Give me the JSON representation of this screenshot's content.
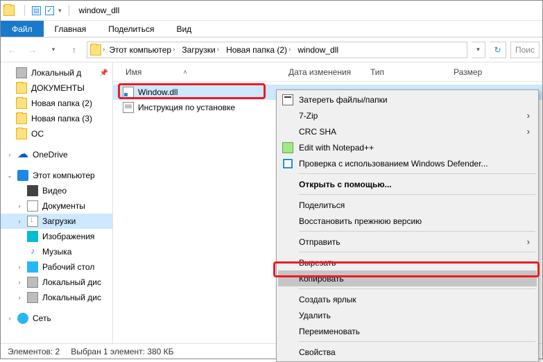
{
  "window": {
    "title": "window_dll"
  },
  "ribbon": {
    "tabs": [
      "Файл",
      "Главная",
      "Поделиться",
      "Вид"
    ]
  },
  "breadcrumb": {
    "segs": [
      "Этот компьютер",
      "Загрузки",
      "Новая папка (2)",
      "window_dll"
    ]
  },
  "search": {
    "placeholder": "Поис"
  },
  "tree": {
    "quick": "Локальный д",
    "items1": [
      "ДОКУМЕНТЫ",
      "Новая папка (2)",
      "Новая папка (3)",
      "ОС"
    ],
    "onedrive": "OneDrive",
    "pc": "Этот компьютер",
    "sub": [
      "Видео",
      "Документы",
      "Загрузки",
      "Изображения",
      "Музыка",
      "Рабочий стол",
      "Локальный дис",
      "Локальный дис"
    ],
    "net": "Сеть"
  },
  "cols": {
    "name": "Имя",
    "date": "Дата изменения",
    "type": "Тип",
    "size": "Размер"
  },
  "files": {
    "f1": "Window.dll",
    "f2": "Инструкция по установке"
  },
  "ctx": {
    "shred": "Затереть файлы/папки",
    "zip": "7-Zip",
    "crc": "CRC SHA",
    "npp": "Edit with Notepad++",
    "def": "Проверка с использованием Windows Defender...",
    "openwith": "Открыть с помощью...",
    "share": "Поделиться",
    "restore": "Восстановить прежнюю версию",
    "send": "Отправить",
    "cut": "Вырезать",
    "copy": "Копировать",
    "shortcut": "Создать ярлык",
    "delete": "Удалить",
    "rename": "Переименовать",
    "props": "Свойства"
  },
  "status": {
    "count": "Элементов: 2",
    "sel": "Выбран 1 элемент: 380 КБ"
  }
}
